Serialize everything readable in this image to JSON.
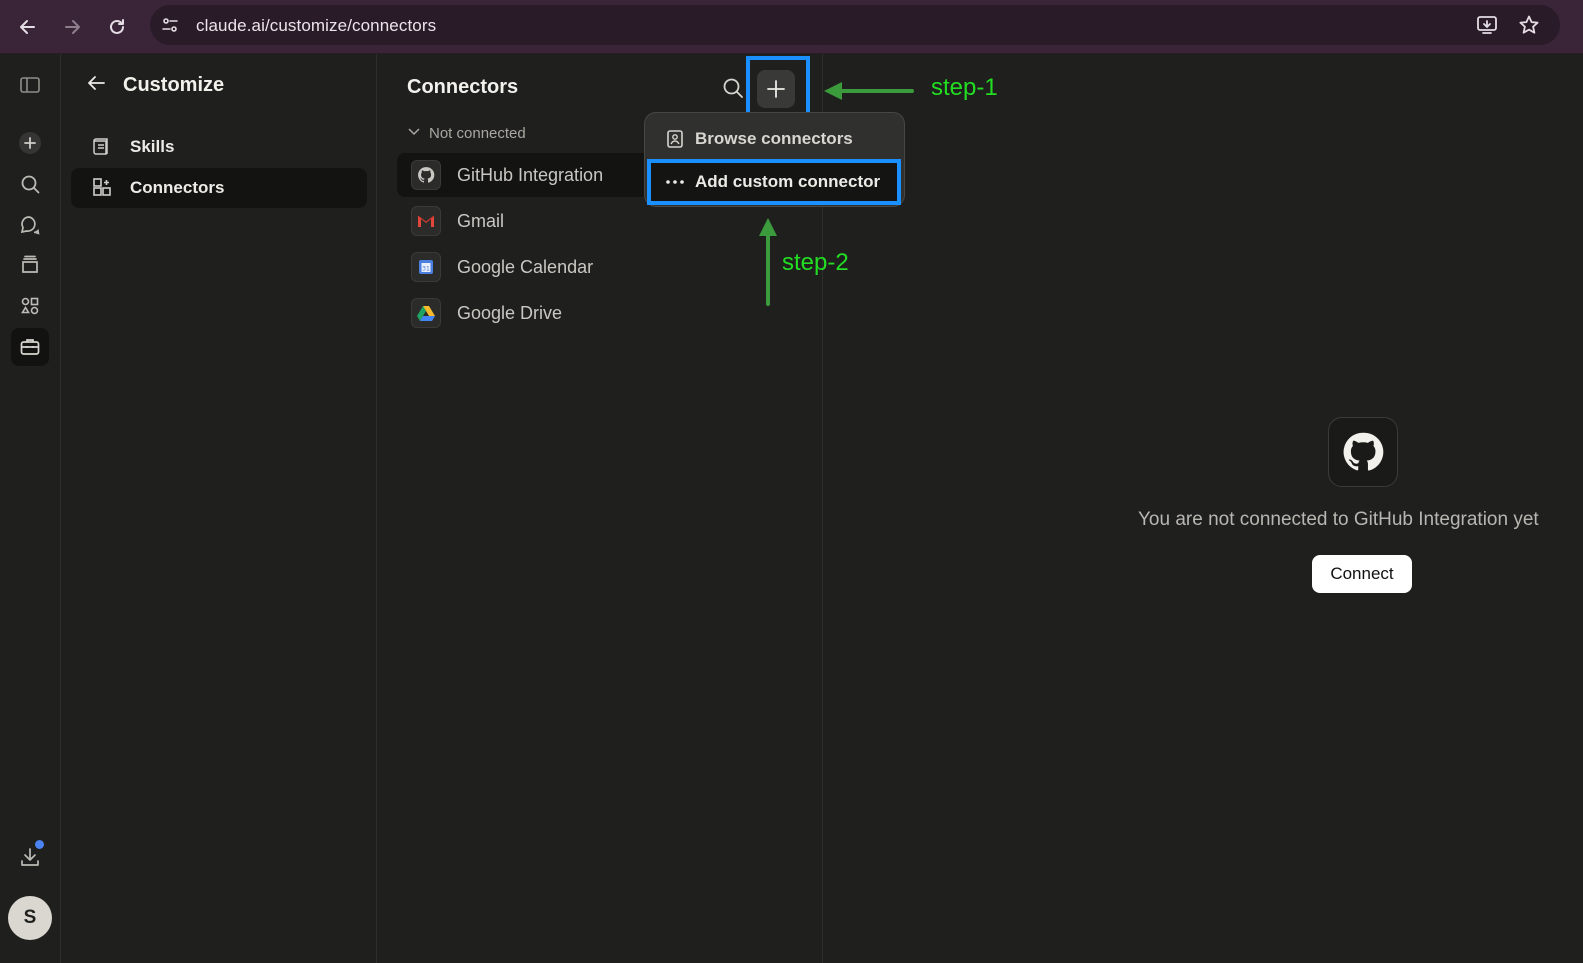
{
  "browser": {
    "url": "claude.ai/customize/connectors"
  },
  "customize": {
    "title": "Customize",
    "items": [
      {
        "label": "Skills"
      },
      {
        "label": "Connectors"
      }
    ]
  },
  "connectors": {
    "title": "Connectors",
    "section_label": "Not connected",
    "items": [
      {
        "label": "GitHub Integration"
      },
      {
        "label": "Gmail"
      },
      {
        "label": "Google Calendar"
      },
      {
        "label": "Google Drive"
      }
    ]
  },
  "menu": {
    "browse_label": "Browse connectors",
    "custom_label": "Add custom connector"
  },
  "annotations": {
    "step1": "step-1",
    "step2": "step-2",
    "box_color": "#1a8fff",
    "arrow_color": "#3b9a3b",
    "text_color": "#22dd22"
  },
  "detail": {
    "message": "You are not connected to GitHub Integration yet",
    "connect_label": "Connect"
  },
  "user": {
    "avatar_letter": "S"
  }
}
